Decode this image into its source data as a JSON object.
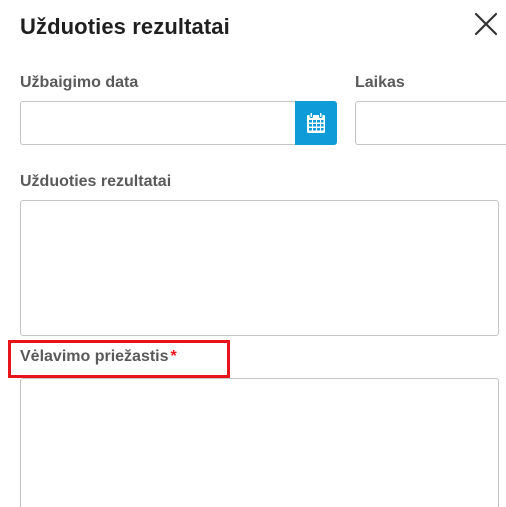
{
  "dialog": {
    "title": "Užduoties rezultatai",
    "close_icon": "close-icon"
  },
  "fields": {
    "completion_date": {
      "label": "Užbaigimo data",
      "value": "",
      "picker_icon": "calendar-icon"
    },
    "time": {
      "label": "Laikas",
      "value": ""
    },
    "results": {
      "label": "Užduoties rezultatai",
      "value": ""
    },
    "delay_reason": {
      "label": "Vėlavimo priežastis",
      "required_mark": "*",
      "value": ""
    }
  },
  "colors": {
    "accent": "#0e9bd8",
    "required": "#e8141c",
    "highlight": "#e8141c"
  }
}
